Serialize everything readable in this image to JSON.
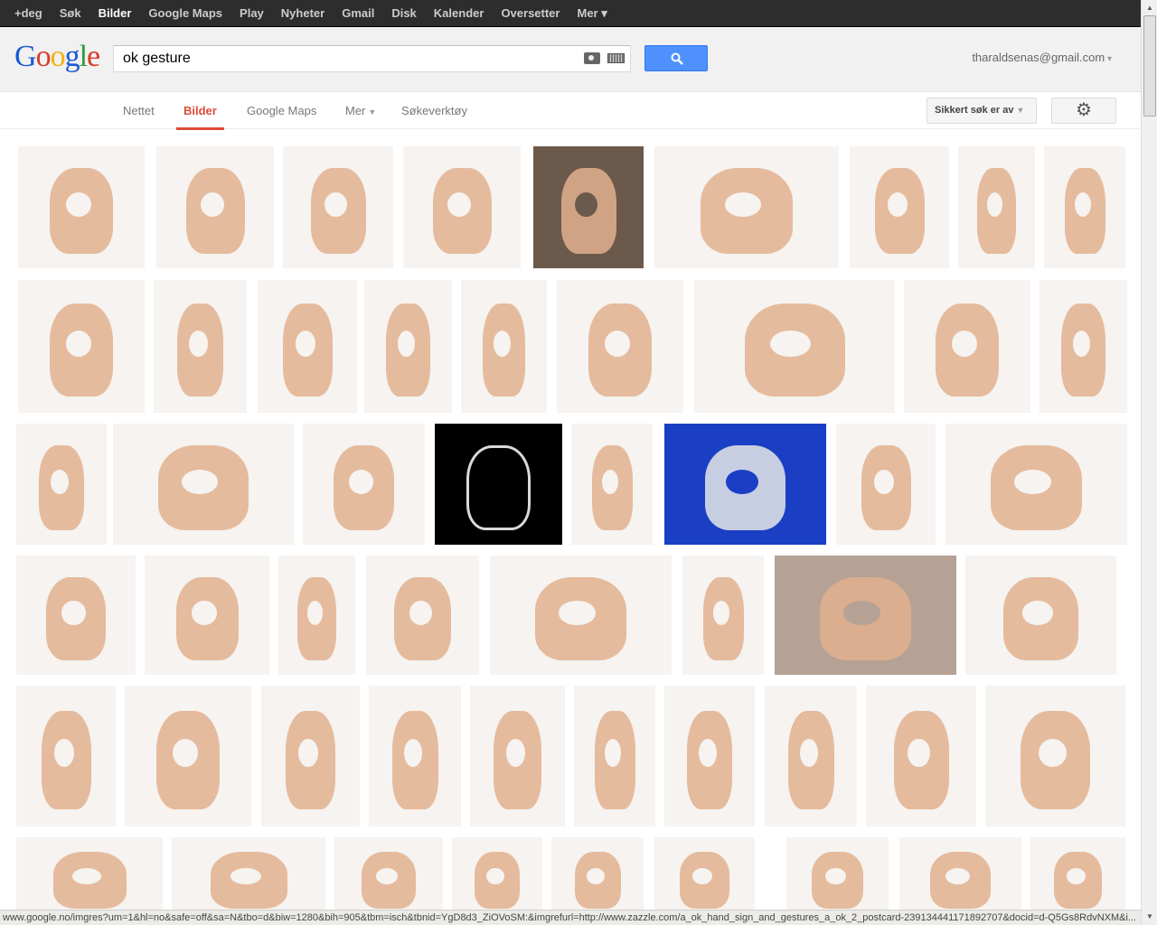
{
  "topbar": {
    "items": [
      "+deg",
      "Søk",
      "Bilder",
      "Google Maps",
      "Play",
      "Nyheter",
      "Gmail",
      "Disk",
      "Kalender",
      "Oversetter",
      "Mer ▾"
    ],
    "active_index": 2
  },
  "logo": "Google",
  "search": {
    "value": "ok gesture"
  },
  "account": "tharaldsenas@gmail.com",
  "tabs": {
    "nettet": "Nettet",
    "bilder": "Bilder",
    "maps": "Google Maps",
    "mer": "Mer",
    "tools": "Søkeverktøy"
  },
  "safe_search": "Sikkert søk er av",
  "status_url": "www.google.no/imgres?um=1&hl=no&safe=off&sa=N&tbo=d&biw=1280&bih=905&tbm=isch&tbnid=YgD8d3_ZiOVoSM:&imgrefurl=http://www.zazzle.com/a_ok_hand_sign_and_gestures_a_ok_2_postcard-239134441171892707&docid=d-Q5Gs8RdvNXM&i...",
  "colors": {
    "accent": "#dd4b39",
    "button": "#4d90fe",
    "topbar": "#2d2d2d"
  }
}
